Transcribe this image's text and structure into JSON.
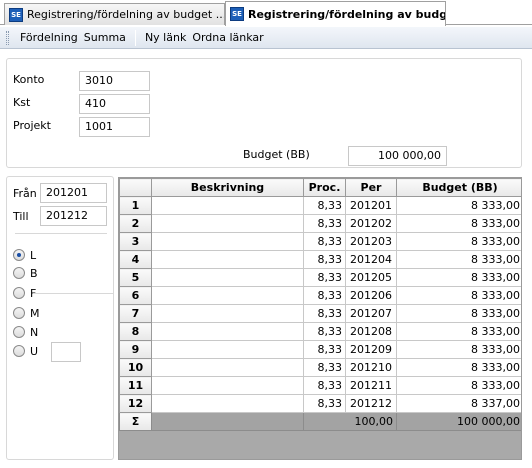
{
  "tabs": [
    {
      "icon": "SE",
      "label": "Registrering/fördelning av budget ..."
    },
    {
      "icon": "SE",
      "label": "Registrering/fördelning av budge..."
    }
  ],
  "toolbar": {
    "items": [
      "Fördelning",
      "Summa",
      "Ny länk",
      "Ordna länkar"
    ]
  },
  "form": {
    "konto_label": "Konto",
    "konto_value": "3010",
    "kst_label": "Kst",
    "kst_value": "410",
    "projekt_label": "Projekt",
    "projekt_value": "1001",
    "budget_label": "Budget (BB)",
    "budget_value": "100 000,00"
  },
  "period": {
    "fran_label": "Från",
    "fran_value": "201201",
    "till_label": "Till",
    "till_value": "201212"
  },
  "radio": {
    "options": [
      "L",
      "B",
      "F",
      "M",
      "N",
      "U"
    ],
    "selected": "L",
    "u_value": ""
  },
  "grid": {
    "headers": [
      "",
      "Beskrivning",
      "Proc.",
      "Per",
      "Budget (BB)"
    ],
    "rows": [
      [
        "1",
        "",
        "8,33",
        "201201",
        "8 333,00"
      ],
      [
        "2",
        "",
        "8,33",
        "201202",
        "8 333,00"
      ],
      [
        "3",
        "",
        "8,33",
        "201203",
        "8 333,00"
      ],
      [
        "4",
        "",
        "8,33",
        "201204",
        "8 333,00"
      ],
      [
        "5",
        "",
        "8,33",
        "201205",
        "8 333,00"
      ],
      [
        "6",
        "",
        "8,33",
        "201206",
        "8 333,00"
      ],
      [
        "7",
        "",
        "8,33",
        "201207",
        "8 333,00"
      ],
      [
        "8",
        "",
        "8,33",
        "201208",
        "8 333,00"
      ],
      [
        "9",
        "",
        "8,33",
        "201209",
        "8 333,00"
      ],
      [
        "10",
        "",
        "8,33",
        "201210",
        "8 333,00"
      ],
      [
        "11",
        "",
        "8,33",
        "201211",
        "8 333,00"
      ],
      [
        "12",
        "",
        "8,33",
        "201212",
        "8 337,00"
      ]
    ],
    "sum": {
      "symbol": "Σ",
      "description": "",
      "proc": "100,00",
      "per": "",
      "budget": "100 000,00"
    }
  }
}
